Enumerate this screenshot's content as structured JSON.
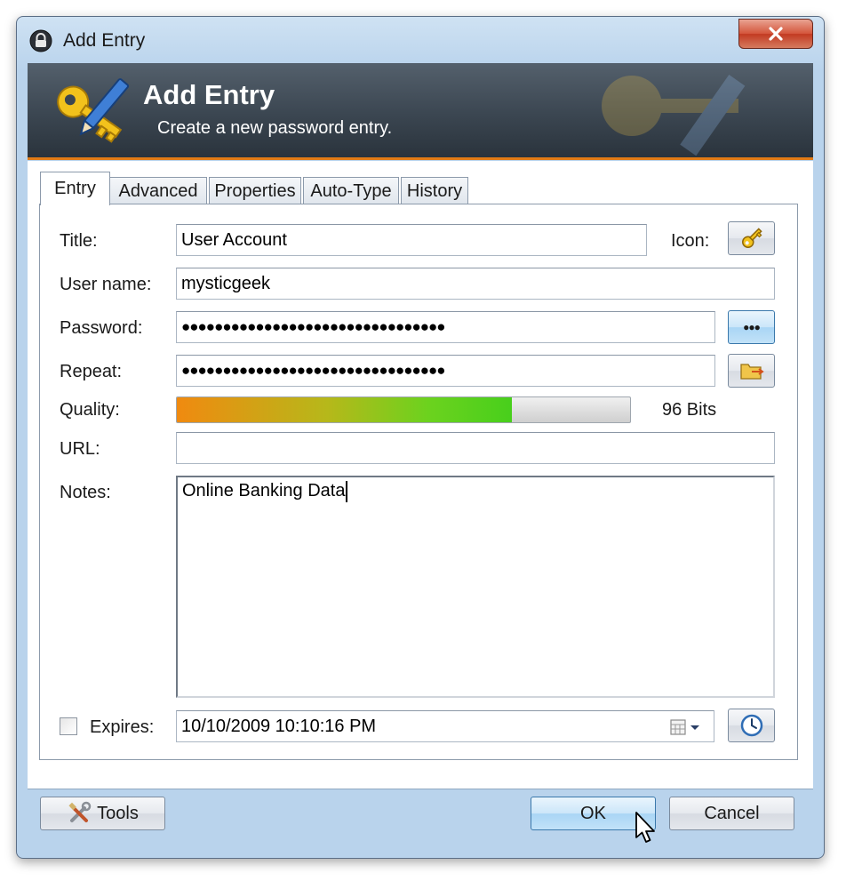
{
  "window": {
    "title": "Add Entry",
    "close_icon": "close-icon"
  },
  "banner": {
    "title": "Add Entry",
    "subtitle": "Create a new password entry.",
    "accent_color": "#e27b16"
  },
  "tabs": [
    {
      "label": "Entry",
      "active": true
    },
    {
      "label": "Advanced",
      "active": false
    },
    {
      "label": "Properties",
      "active": false
    },
    {
      "label": "Auto-Type",
      "active": false
    },
    {
      "label": "History",
      "active": false
    }
  ],
  "form": {
    "title_label": "Title:",
    "title_value": "User Account",
    "icon_label": "Icon:",
    "username_label": "User name:",
    "username_value": "mysticgeek",
    "password_label": "Password:",
    "password_value": "●●●●●●●●●●●●●●●●●●●●●●●●●●●●●●●●",
    "show_password_label": "●●●",
    "repeat_label": "Repeat:",
    "repeat_value": "●●●●●●●●●●●●●●●●●●●●●●●●●●●●●●●●",
    "quality_label": "Quality:",
    "quality_fraction": 0.74,
    "quality_text": "96 Bits",
    "url_label": "URL:",
    "url_value": "",
    "notes_label": "Notes:",
    "notes_value": "Online Banking Data",
    "expires_label": "Expires:",
    "expires_checked": false,
    "expires_value": "10/10/2009 10:10:16 PM"
  },
  "footer": {
    "tools_label": "Tools",
    "ok_label": "OK",
    "cancel_label": "Cancel"
  }
}
